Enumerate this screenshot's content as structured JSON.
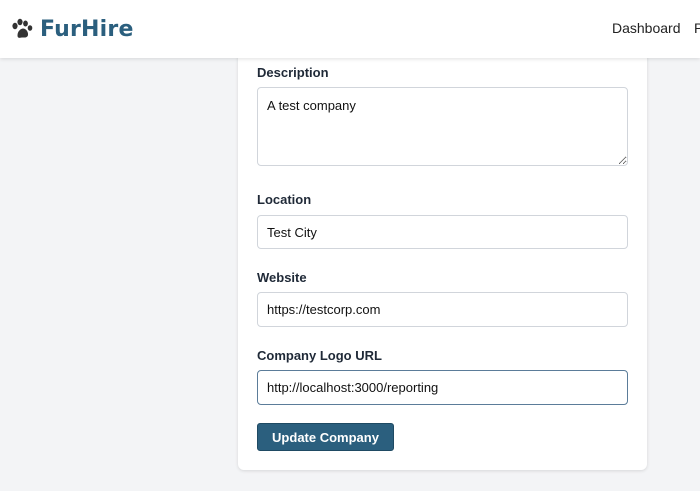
{
  "navbar": {
    "brand_name": "FurHire",
    "brand_icon": "paw-icon",
    "brand_color": "#2b5f7e",
    "links": [
      "Dashboard",
      "P"
    ]
  },
  "form": {
    "description": {
      "label": "Description",
      "value": "A test company"
    },
    "location": {
      "label": "Location",
      "value": "Test City"
    },
    "website": {
      "label": "Website",
      "value": "https://testcorp.com"
    },
    "logo_url": {
      "label": "Company Logo URL",
      "value": "http://localhost:3000/reporting"
    },
    "submit_label": "Update Company",
    "submit_color": "#2b5f7e"
  }
}
